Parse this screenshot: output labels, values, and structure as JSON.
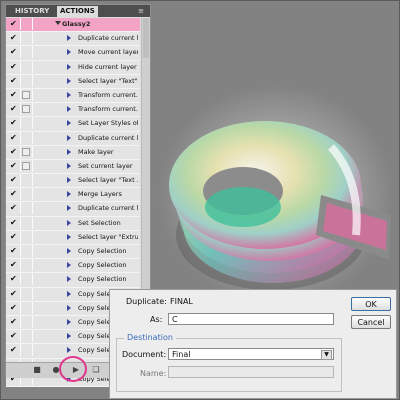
{
  "tabs": {
    "history": "HISTORY",
    "actions": "ACTIONS",
    "menu": "≡"
  },
  "actions": [
    {
      "label": "Glassy2",
      "checked": true,
      "dialog": false,
      "set": true
    },
    {
      "label": "Duplicate current l...",
      "checked": true,
      "dialog": false
    },
    {
      "label": "Move current layer",
      "checked": true,
      "dialog": false
    },
    {
      "label": "Hide current layer",
      "checked": true,
      "dialog": false
    },
    {
      "label": "Select layer \"Text\"",
      "checked": true,
      "dialog": false
    },
    {
      "label": "Transform current...",
      "checked": true,
      "dialog": true
    },
    {
      "label": "Transform current...",
      "checked": true,
      "dialog": true
    },
    {
      "label": "Set Layer Styles of...",
      "checked": true,
      "dialog": false
    },
    {
      "label": "Duplicate current l...",
      "checked": true,
      "dialog": false
    },
    {
      "label": "Make layer",
      "checked": true,
      "dialog": true
    },
    {
      "label": "Set current layer",
      "checked": true,
      "dialog": true
    },
    {
      "label": "Select layer \"Text ...",
      "checked": true,
      "dialog": false
    },
    {
      "label": "Merge Layers",
      "checked": true,
      "dialog": false
    },
    {
      "label": "Duplicate current l...",
      "checked": true,
      "dialog": false
    },
    {
      "label": "Set Selection",
      "checked": true,
      "dialog": false
    },
    {
      "label": "Select layer \"Extru...",
      "checked": true,
      "dialog": false
    },
    {
      "label": "Copy Selection",
      "checked": true,
      "dialog": false
    },
    {
      "label": "Copy Selection",
      "checked": true,
      "dialog": false
    },
    {
      "label": "Copy Selection",
      "checked": true,
      "dialog": false
    },
    {
      "label": "Copy Selection",
      "checked": true,
      "dialog": false
    },
    {
      "label": "Copy Selection",
      "checked": true,
      "dialog": false
    },
    {
      "label": "Copy Selection",
      "checked": true,
      "dialog": false
    },
    {
      "label": "Copy Selection",
      "checked": true,
      "dialog": false
    },
    {
      "label": "Copy Selection",
      "checked": true,
      "dialog": false
    },
    {
      "label": "Copy Selection",
      "checked": true,
      "dialog": false
    },
    {
      "label": "Copy Selection",
      "checked": true,
      "dialog": false
    }
  ],
  "footer": {
    "stop": "■",
    "record": "●",
    "play": "▶",
    "new_set": "❏",
    "new_action": "▣",
    "delete": "⌫"
  },
  "dialog": {
    "duplicate_label": "Duplicate:",
    "duplicate_value": "FINAL",
    "as_label": "As:",
    "as_value": "C",
    "ok": "OK",
    "cancel": "Cancel",
    "destination_label": "Destination",
    "document_label": "Document:",
    "document_value": "Final",
    "name_label": "Name:",
    "name_value": ""
  },
  "colors": {
    "highlight": "#f2a3c6",
    "ring": "#e0368c",
    "accent": "#3c6bbf"
  }
}
